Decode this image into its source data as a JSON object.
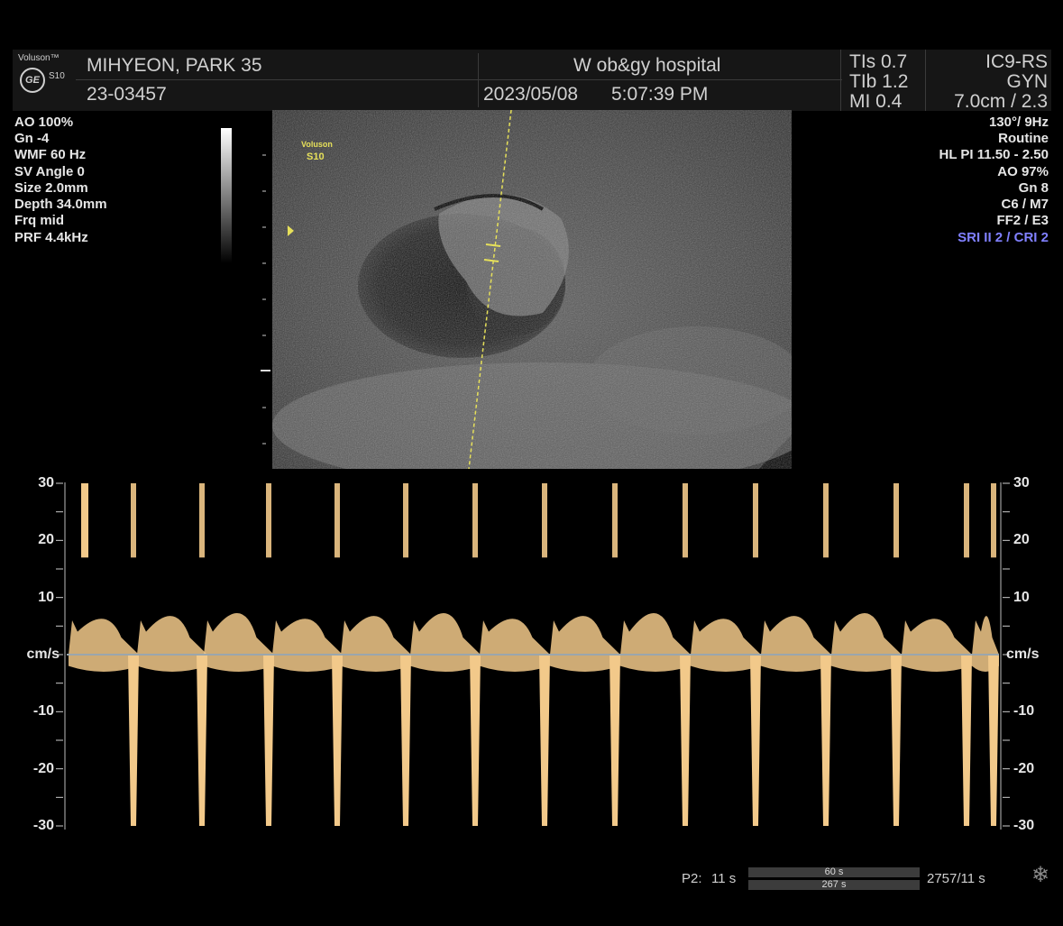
{
  "header": {
    "brand": "Voluson™",
    "model": "S10",
    "logo": "GE",
    "patient_name": "MIHYEON, PARK  35",
    "patient_id": "23-03457",
    "hospital": "W ob&gy hospital",
    "date": "2023/05/08",
    "time": "5:07:39 PM",
    "tis": "TIs  0.7",
    "tib": "TIb  1.2",
    "mi": "MI  0.4",
    "probe": "IC9-RS",
    "preset": "GYN",
    "depth": "7.0cm / 2.3"
  },
  "left_params": [
    "AO 100%",
    "Gn  -4",
    "WMF 60 Hz",
    "SV Angle  0",
    "Size  2.0mm",
    "Depth 34.0mm",
    "Frq mid",
    "PRF  4.4kHz"
  ],
  "right_params": [
    "130°/  9Hz",
    "Routine",
    "HL PI 11.50 - 2.50",
    "AO 97%",
    "Gn   8",
    "C6 / M7",
    "FF2 / E3"
  ],
  "right_highlight": "SRI II 2 / CRI 2",
  "image_label": {
    "line1": "Voluson",
    "line2": "S10"
  },
  "doppler": {
    "unit": "cm/s",
    "ticks": [
      "30",
      "20",
      "10",
      "-10",
      "-20",
      "-30"
    ],
    "tick_values": [
      30,
      20,
      10,
      -10,
      -20,
      -30
    ],
    "range": [
      -30,
      30
    ]
  },
  "footer": {
    "p2_label": "P2:",
    "p2_value": "11 s",
    "bar1": "60 s",
    "bar2": "267 s",
    "counter": "2757/11 s",
    "icon": "freeze-snowflake-icon"
  },
  "colors": {
    "doppler": "#f2c98a",
    "accent_yellow": "#e6e05a",
    "highlight": "#7e7eff"
  }
}
